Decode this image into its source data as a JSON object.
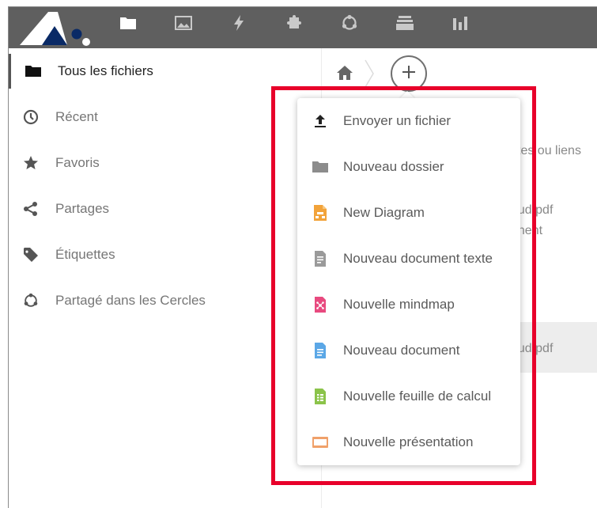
{
  "header": {
    "apps": [
      {
        "icon": "folder-icon"
      },
      {
        "icon": "image-icon"
      },
      {
        "icon": "activity-icon"
      },
      {
        "icon": "puzzle-icon"
      },
      {
        "icon": "circles-icon"
      },
      {
        "icon": "deck-icon"
      },
      {
        "icon": "bar-chart-icon"
      }
    ]
  },
  "sidebar": {
    "items": [
      {
        "label": "Tous les fichiers",
        "icon": "folder-icon",
        "active": true
      },
      {
        "label": "Récent",
        "icon": "clock-icon"
      },
      {
        "label": "Favoris",
        "icon": "star-icon"
      },
      {
        "label": "Partages",
        "icon": "share-icon"
      },
      {
        "label": "Étiquettes",
        "icon": "tag-icon"
      },
      {
        "label": "Partagé dans les Cercles",
        "icon": "circles-icon"
      }
    ]
  },
  "main": {
    "background_fragments": [
      "stes ou liens",
      "oud.pdf",
      "nnent",
      "oud.pdf"
    ]
  },
  "new_menu": {
    "items": [
      {
        "label": "Envoyer un fichier",
        "icon": "upload-icon",
        "color": "#222222"
      },
      {
        "label": "Nouveau dossier",
        "icon": "folder-icon",
        "color": "#8c8c8c"
      },
      {
        "label": "New Diagram",
        "icon": "diagram-icon",
        "color": "#f2a33a"
      },
      {
        "label": "Nouveau document texte",
        "icon": "text-file-icon",
        "color": "#9a9a9a"
      },
      {
        "label": "Nouvelle mindmap",
        "icon": "mindmap-icon",
        "color": "#e84a7f"
      },
      {
        "label": "Nouveau document",
        "icon": "document-icon",
        "color": "#5ba7e6"
      },
      {
        "label": "Nouvelle feuille de calcul",
        "icon": "spreadsheet-icon",
        "color": "#8bc34a"
      },
      {
        "label": "Nouvelle présentation",
        "icon": "presentation-icon",
        "color": "#f0a16a"
      }
    ]
  },
  "colors": {
    "header_bg": "#5f5f5f",
    "highlight_border": "#e8002a",
    "logo_accent": "#0a2a66"
  }
}
